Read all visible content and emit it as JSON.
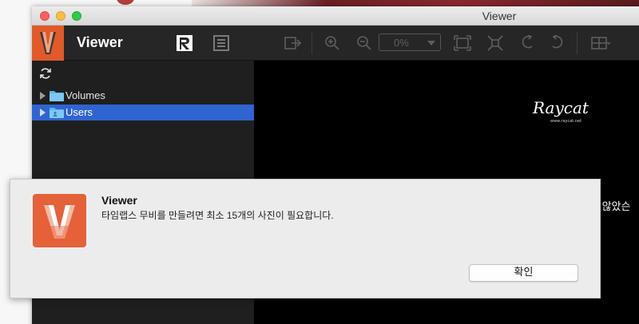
{
  "window": {
    "title": "Viewer"
  },
  "toolbar": {
    "app_name": "Viewer",
    "zoom_value": "0%"
  },
  "sidebar": {
    "items": [
      {
        "label": "Volumes",
        "selected": false
      },
      {
        "label": "Users",
        "selected": true
      }
    ]
  },
  "content": {
    "watermark": "Raycat",
    "watermark_url": "www.raycat.net",
    "partial_text": "지 않았슨"
  },
  "alert": {
    "title": "Viewer",
    "message": "타임랩스 무비를 만들려면 최소 15개의 사진이 필요합니다.",
    "ok_label": "확인"
  },
  "colors": {
    "accent": "#e05a2b",
    "selection": "#2f64d1",
    "toolbar_bg": "#262626",
    "sidebar_bg": "#1f1f1f"
  }
}
